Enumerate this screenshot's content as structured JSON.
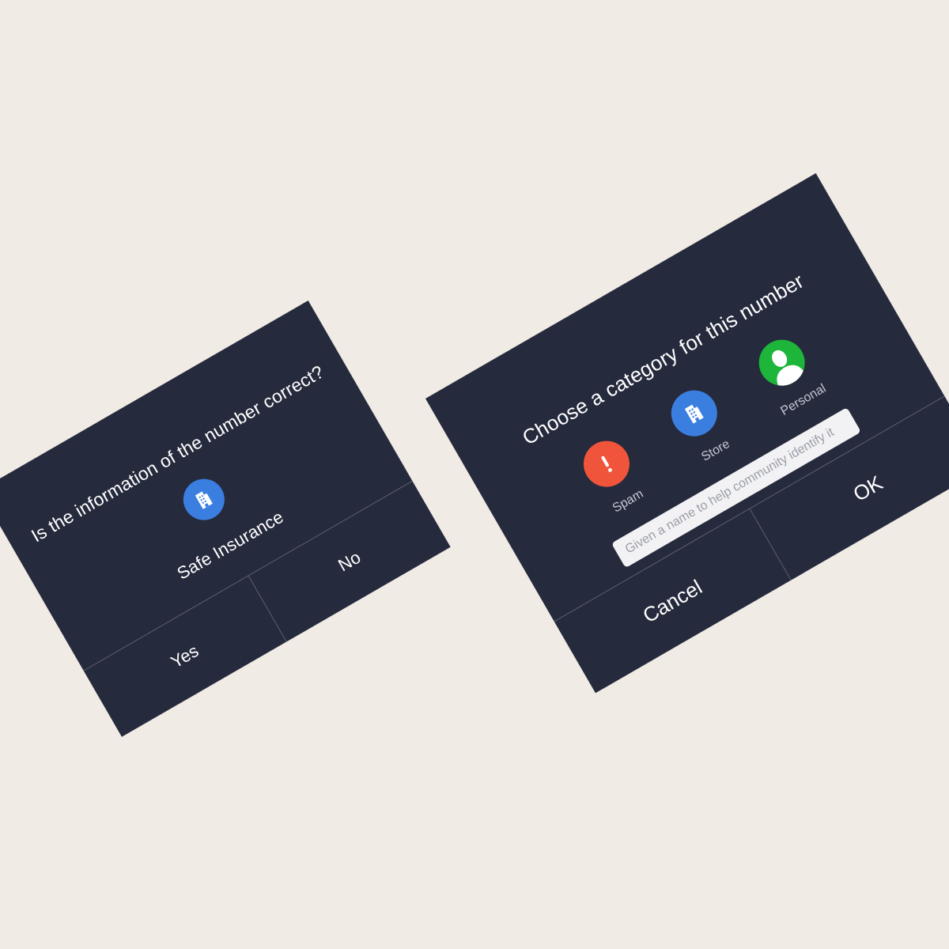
{
  "confirm_dialog": {
    "title": "Is the information of the number correct?",
    "entity_name": "Safe Insurance",
    "entity_icon": "building-icon",
    "yes_label": "Yes",
    "no_label": "No"
  },
  "category_dialog": {
    "title": "Choose a category for this number",
    "categories": [
      {
        "label": "Spam",
        "icon": "exclamation-icon",
        "color": "#f0553b"
      },
      {
        "label": "Store",
        "icon": "building-icon",
        "color": "#3a7fe0"
      },
      {
        "label": "Personal",
        "icon": "person-icon",
        "color": "#1db53a"
      }
    ],
    "name_placeholder": "Given a name to help community identify it",
    "cancel_label": "Cancel",
    "ok_label": "OK"
  },
  "colors": {
    "dialog_bg": "#262a3d",
    "page_bg": "#f0ebe5",
    "entity_icon_bg": "#3a7fe0"
  }
}
